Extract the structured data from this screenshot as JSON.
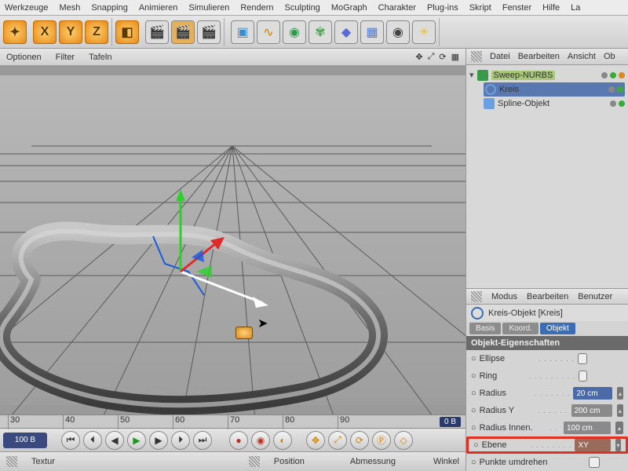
{
  "menu": {
    "items": [
      "Werkzeuge",
      "Mesh",
      "Snapping",
      "Animieren",
      "Simulieren",
      "Rendern",
      "Sculpting",
      "MoGraph",
      "Charakter",
      "Plug-ins",
      "Skript",
      "Fenster",
      "Hilfe",
      "La"
    ]
  },
  "axes": {
    "x": "X",
    "y": "Y",
    "z": "Z"
  },
  "view_opts": {
    "a": "Optionen",
    "b": "Filter",
    "c": "Tafeln"
  },
  "om_menu": {
    "a": "Datei",
    "b": "Bearbeiten",
    "c": "Ansicht",
    "d": "Ob"
  },
  "tree": {
    "n0": "Sweep-NURBS",
    "n1": "Kreis",
    "n2": "Spline-Objekt"
  },
  "ruler": {
    "t30": "30",
    "t40": "40",
    "t50": "50",
    "t60": "60",
    "t70": "70",
    "t80": "80",
    "t90": "90",
    "ob": "0 B"
  },
  "play": {
    "frame": "100 B"
  },
  "bottom": {
    "a": "Textur",
    "b": "Position",
    "c": "Abmessung",
    "d": "Winkel"
  },
  "attr_menu": {
    "a": "Modus",
    "b": "Bearbeiten",
    "c": "Benutzer"
  },
  "attr_title": "Kreis-Objekt [Kreis]",
  "tabs": {
    "a": "Basis",
    "b": "Koord.",
    "c": "Objekt"
  },
  "section": "Objekt-Eigenschaften",
  "props": {
    "ellipse": "Ellipse",
    "ring": "Ring",
    "radius": "Radius",
    "radius_v": "20 cm",
    "radiusy": "Radius Y",
    "radiusy_v": "200 cm",
    "radiusi": "Radius Innen.",
    "radiusi_v": "100 cm",
    "ebene": "Ebene",
    "ebene_v": "XY",
    "punkte": "Punkte umdrehen"
  }
}
